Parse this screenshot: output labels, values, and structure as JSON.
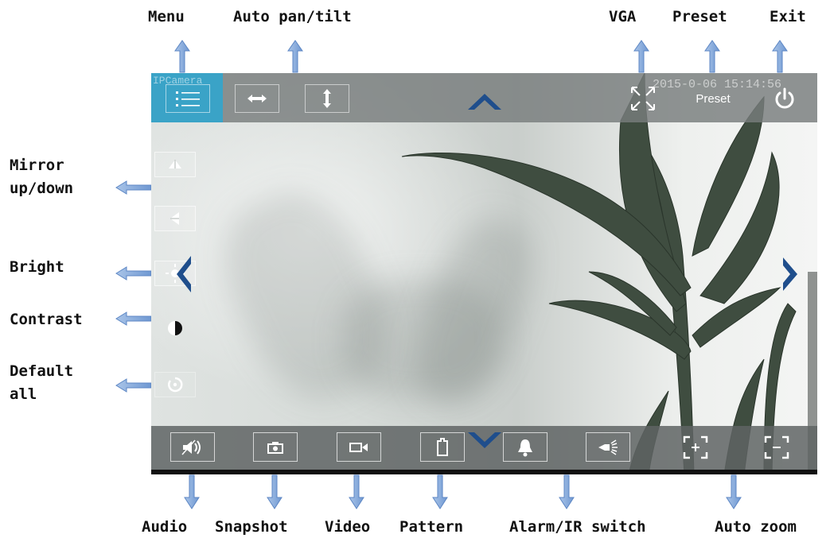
{
  "annotations": {
    "menu": "Menu",
    "auto_pan_tilt": "Auto pan/tilt",
    "vga": "VGA",
    "preset": "Preset",
    "exit": "Exit",
    "mirror_line1": "Mirror",
    "mirror_line2": "up/down",
    "bright": "Bright",
    "contrast": "Contrast",
    "default_line1": "Default",
    "default_line2": "all",
    "audio": "Audio",
    "snapshot": "Snapshot",
    "video": "Video",
    "pattern": "Pattern",
    "alarm_ir": "Alarm/IR switch",
    "auto_zoom": "Auto zoom"
  },
  "camera": {
    "osd_name": "IPCamera",
    "osd_timestamp": "2015-0-06 15:14:56",
    "preset_label": "Preset"
  },
  "icons": {
    "menu": "list-icon",
    "pan": "horizontal-arrows-icon",
    "tilt": "vertical-arrows-icon",
    "vga": "fullscreen-icon",
    "exit": "power-icon",
    "mirror_ud": "flip-vertical-icon",
    "mirror_lr": "flip-horizontal-icon",
    "bright": "sun-icon",
    "contrast": "contrast-icon",
    "default": "reset-icon",
    "audio": "speaker-icon",
    "snapshot": "camera-icon",
    "video": "video-camera-icon",
    "pattern": "pattern-icon",
    "alarm": "bell-icon",
    "ir": "ir-light-icon",
    "zoom_in": "zoom-in-icon",
    "zoom_out": "zoom-out-icon"
  },
  "colors": {
    "accent": "#3aa3c7",
    "ptz_arrow": "#1f4e8c",
    "callout_arrow": "#7ea4d8"
  }
}
